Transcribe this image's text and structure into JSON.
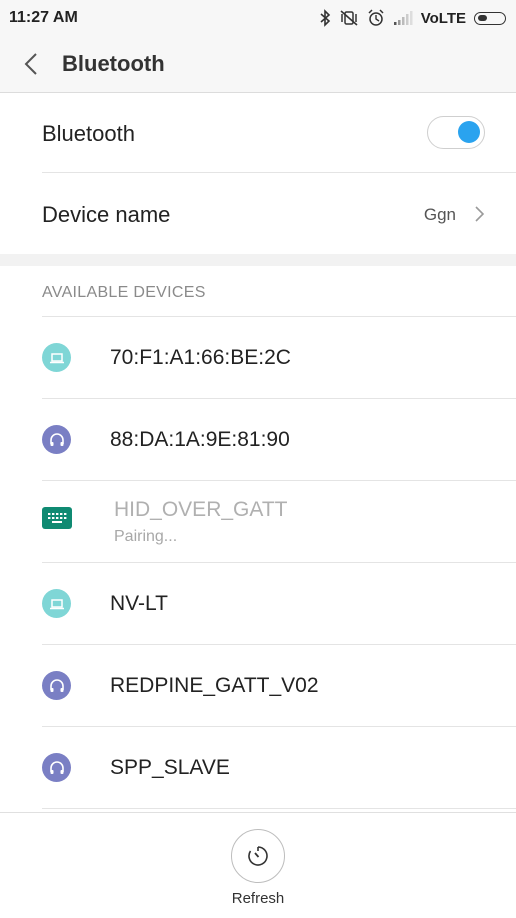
{
  "status_bar": {
    "time": "11:27 AM",
    "network": "VoLTE",
    "icons": [
      "bluetooth-icon",
      "mute-vibrate-icon",
      "alarm-icon",
      "signal-icon",
      "battery-icon"
    ]
  },
  "header": {
    "back_icon": "chevron-left-icon",
    "title": "Bluetooth"
  },
  "settings": {
    "bluetooth_label": "Bluetooth",
    "bluetooth_enabled": true,
    "device_name_label": "Device name",
    "device_name_value": "Ggn"
  },
  "available_devices": {
    "header": "AVAILABLE DEVICES",
    "items": [
      {
        "name": "70:F1:A1:66:BE:2C",
        "icon": "laptop-icon",
        "color": "#7fd6d6"
      },
      {
        "name": "88:DA:1A:9E:81:90",
        "icon": "headphones-icon",
        "color": "#7a7fc4"
      },
      {
        "name": "HID_OVER_GATT",
        "status": "Pairing...",
        "icon": "keyboard-icon",
        "color": "#0f8a72"
      },
      {
        "name": "NV-LT",
        "icon": "laptop-icon",
        "color": "#7fd6d6"
      },
      {
        "name": "REDPINE_GATT_V02",
        "icon": "headphones-icon",
        "color": "#7a7fc4"
      },
      {
        "name": "SPP_SLAVE",
        "icon": "headphones-icon",
        "color": "#7a7fc4"
      }
    ]
  },
  "bottom": {
    "refresh_label": "Refresh",
    "refresh_icon": "refresh-timer-icon"
  },
  "colors": {
    "accent": "#2aa3ef",
    "laptop": "#7fd6d6",
    "headphones": "#7a7fc4",
    "keyboard": "#0f8a72"
  }
}
